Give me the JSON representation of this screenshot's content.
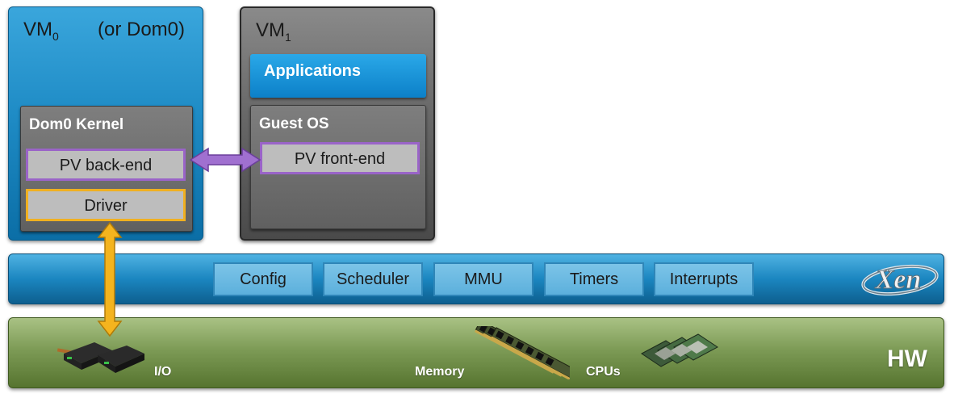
{
  "vm0": {
    "title": "VM",
    "sub": "0",
    "paren": "(or Dom0)"
  },
  "vm1": {
    "title": "VM",
    "sub": "1"
  },
  "dom0_kernel": {
    "title": "Dom0 Kernel",
    "pv_backend": "PV back-end",
    "driver": "Driver"
  },
  "vm1_boxes": {
    "applications": "Applications",
    "guest_os": "Guest OS",
    "pv_frontend": "PV front-end"
  },
  "xen_bar": {
    "components": [
      "Config",
      "Scheduler",
      "MMU",
      "Timers",
      "Interrupts"
    ],
    "logo_text": "Xen"
  },
  "hw_bar": {
    "io": "I/O",
    "memory": "Memory",
    "cpus": "CPUs",
    "title": "HW"
  },
  "colors": {
    "vm0_blue": "#1f8cc6",
    "vm1_gray": "#6c6c6c",
    "pv_border": "#9a64c8",
    "driver_border": "#f0b020",
    "xen_blue": "#1b86c0",
    "hw_green": "#7d9b56"
  }
}
